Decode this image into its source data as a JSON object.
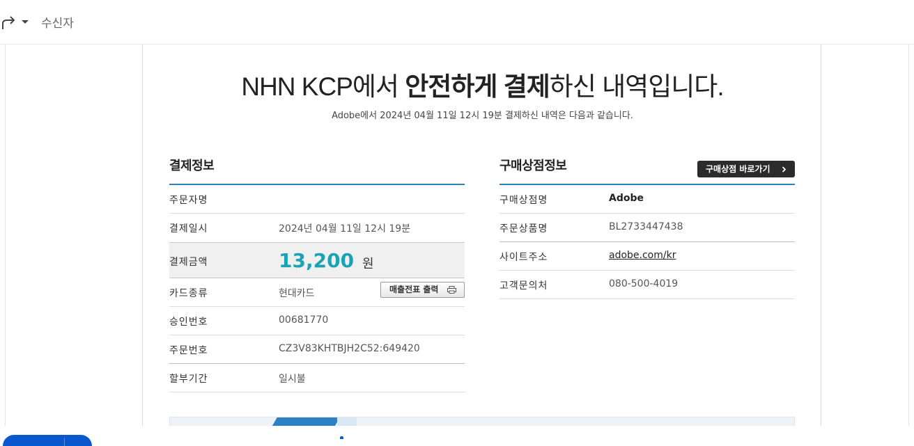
{
  "topbar": {
    "forward_icon": "forward-icon",
    "dropdown_icon": "caret-down-icon",
    "recipient_label": "수신자"
  },
  "receipt": {
    "headline_prefix": "NHN KCP에서 ",
    "headline_bold1": "안전하게 결제",
    "headline_suffix": "하신 내역입니다.",
    "subline": "Adobe에서 2024년 04월 11일 12시 19분 결제하신 내역은 다음과 같습니다.",
    "payment": {
      "title": "결제정보",
      "orderer_label": "주문자명",
      "orderer_value": "",
      "date_label": "결제일시",
      "date_value": "2024년 04월 11일 12시 19분",
      "amount_label": "결제금액",
      "amount_value": "13,200",
      "amount_unit": "원",
      "card_label": "카드종류",
      "card_value": "현대카드",
      "print_button": "매출전표 출력",
      "approval_label": "승인번호",
      "approval_value": "00681770",
      "order_no_label": "주문번호",
      "order_no_value": "CZ3V83KHTBJH2C52:649420",
      "installment_label": "할부기간",
      "installment_value": "일시불"
    },
    "merchant": {
      "title": "구매상점정보",
      "go_button": "구매상점 바로가기",
      "name_label": "구매상점명",
      "name_value": "Adobe",
      "product_label": "주문상품명",
      "product_value": "BL2733447438",
      "site_label": "사이트주소",
      "site_value": "adobe.com/kr",
      "contact_label": "고객문의처",
      "contact_value": "080-500-4019"
    }
  },
  "colors": {
    "accent_line": "#2d7fb8",
    "amount": "#19a3b4",
    "dark_button": "#2b2b2b",
    "bottom_pill": "#0b57d0"
  }
}
